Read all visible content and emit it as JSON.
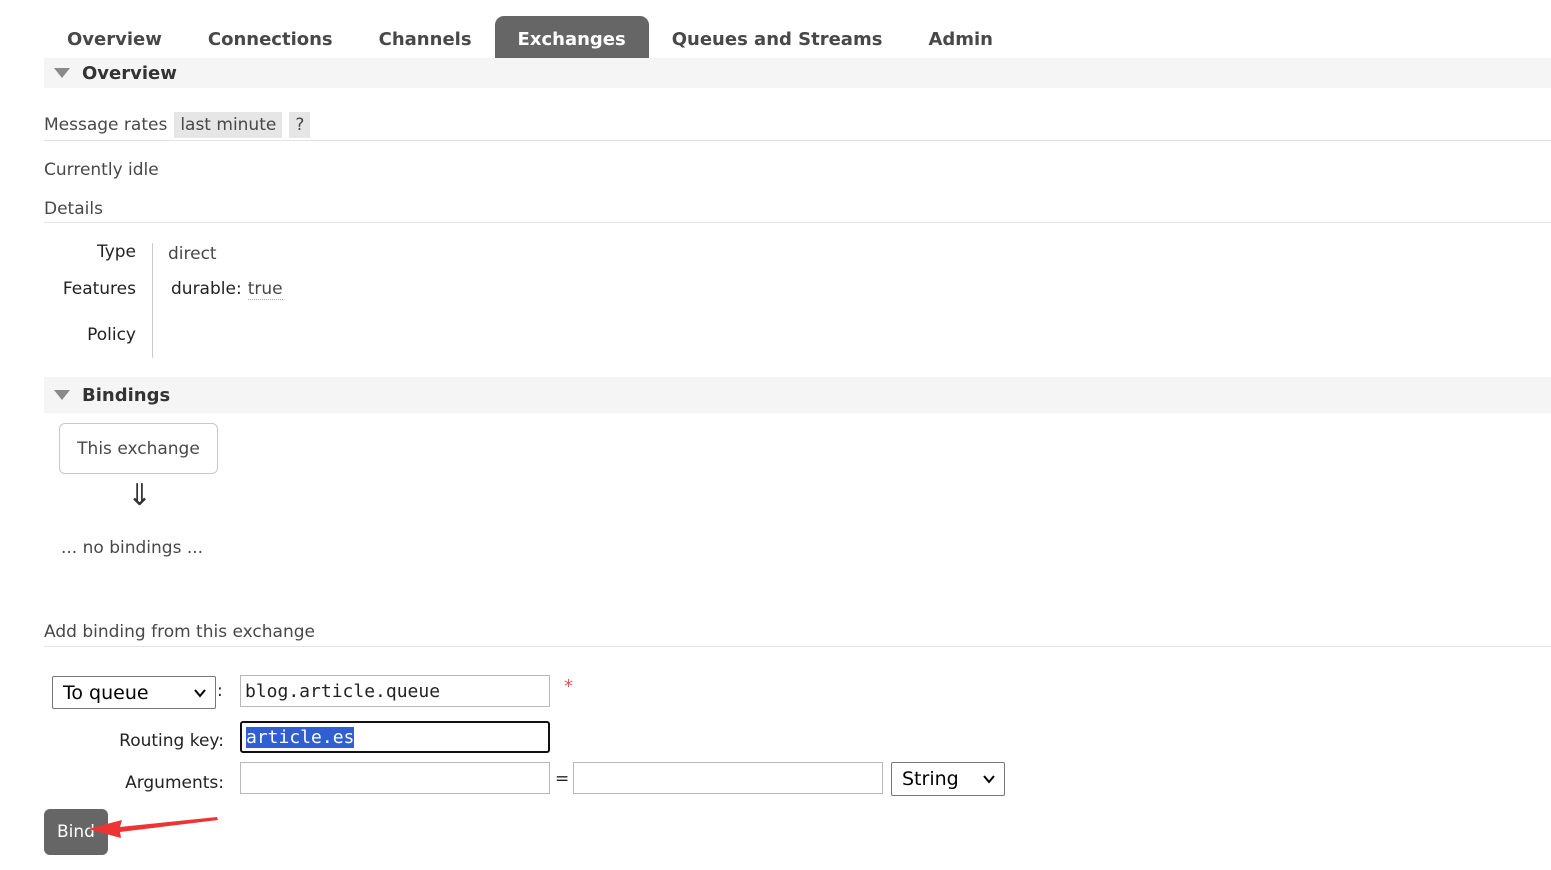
{
  "nav": {
    "tabs": [
      {
        "label": "Overview"
      },
      {
        "label": "Connections"
      },
      {
        "label": "Channels"
      },
      {
        "label": "Exchanges",
        "active": true
      },
      {
        "label": "Queues and Streams"
      },
      {
        "label": "Admin"
      }
    ]
  },
  "overview": {
    "title": "Overview",
    "message_rates_label": "Message rates",
    "rate_period": "last minute",
    "help": "?",
    "status": "Currently idle",
    "details_label": "Details",
    "type_label": "Type",
    "type_value": "direct",
    "features_label": "Features",
    "feature_key": "durable:",
    "feature_value": "true",
    "policy_label": "Policy"
  },
  "bindings": {
    "title": "Bindings",
    "this_exchange": "This exchange",
    "arrow": "⇓",
    "none_text": "... no bindings ..."
  },
  "add_binding": {
    "title": "Add binding from this exchange",
    "destination_type": "To queue",
    "colon": ":",
    "destination_value": "blog.article.queue",
    "required_mark": "*",
    "routing_key_label": "Routing key:",
    "routing_key_value": "article.es",
    "arguments_label": "Arguments:",
    "arg_key": "",
    "equals": "=",
    "arg_value": "",
    "arg_type": "String",
    "bind_label": "Bind"
  },
  "colors": {
    "tab_active": "#666666",
    "section_bg": "#f5f5f5",
    "selection": "#2f5fd0",
    "annotation": "#ee3333"
  },
  "icons": {
    "collapse": "triangle-down-icon",
    "select": "chevron-down-icon",
    "annotation": "red-arrow-icon"
  }
}
